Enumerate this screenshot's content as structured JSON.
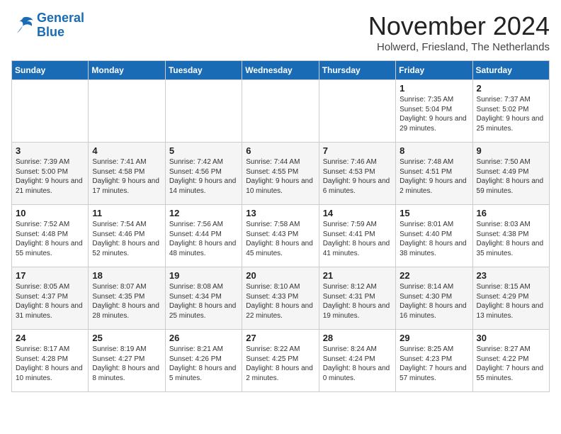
{
  "logo": {
    "line1": "General",
    "line2": "Blue"
  },
  "title": "November 2024",
  "subtitle": "Holwerd, Friesland, The Netherlands",
  "weekdays": [
    "Sunday",
    "Monday",
    "Tuesday",
    "Wednesday",
    "Thursday",
    "Friday",
    "Saturday"
  ],
  "weeks": [
    [
      {
        "day": "",
        "info": ""
      },
      {
        "day": "",
        "info": ""
      },
      {
        "day": "",
        "info": ""
      },
      {
        "day": "",
        "info": ""
      },
      {
        "day": "",
        "info": ""
      },
      {
        "day": "1",
        "info": "Sunrise: 7:35 AM\nSunset: 5:04 PM\nDaylight: 9 hours and 29 minutes."
      },
      {
        "day": "2",
        "info": "Sunrise: 7:37 AM\nSunset: 5:02 PM\nDaylight: 9 hours and 25 minutes."
      }
    ],
    [
      {
        "day": "3",
        "info": "Sunrise: 7:39 AM\nSunset: 5:00 PM\nDaylight: 9 hours and 21 minutes."
      },
      {
        "day": "4",
        "info": "Sunrise: 7:41 AM\nSunset: 4:58 PM\nDaylight: 9 hours and 17 minutes."
      },
      {
        "day": "5",
        "info": "Sunrise: 7:42 AM\nSunset: 4:56 PM\nDaylight: 9 hours and 14 minutes."
      },
      {
        "day": "6",
        "info": "Sunrise: 7:44 AM\nSunset: 4:55 PM\nDaylight: 9 hours and 10 minutes."
      },
      {
        "day": "7",
        "info": "Sunrise: 7:46 AM\nSunset: 4:53 PM\nDaylight: 9 hours and 6 minutes."
      },
      {
        "day": "8",
        "info": "Sunrise: 7:48 AM\nSunset: 4:51 PM\nDaylight: 9 hours and 2 minutes."
      },
      {
        "day": "9",
        "info": "Sunrise: 7:50 AM\nSunset: 4:49 PM\nDaylight: 8 hours and 59 minutes."
      }
    ],
    [
      {
        "day": "10",
        "info": "Sunrise: 7:52 AM\nSunset: 4:48 PM\nDaylight: 8 hours and 55 minutes."
      },
      {
        "day": "11",
        "info": "Sunrise: 7:54 AM\nSunset: 4:46 PM\nDaylight: 8 hours and 52 minutes."
      },
      {
        "day": "12",
        "info": "Sunrise: 7:56 AM\nSunset: 4:44 PM\nDaylight: 8 hours and 48 minutes."
      },
      {
        "day": "13",
        "info": "Sunrise: 7:58 AM\nSunset: 4:43 PM\nDaylight: 8 hours and 45 minutes."
      },
      {
        "day": "14",
        "info": "Sunrise: 7:59 AM\nSunset: 4:41 PM\nDaylight: 8 hours and 41 minutes."
      },
      {
        "day": "15",
        "info": "Sunrise: 8:01 AM\nSunset: 4:40 PM\nDaylight: 8 hours and 38 minutes."
      },
      {
        "day": "16",
        "info": "Sunrise: 8:03 AM\nSunset: 4:38 PM\nDaylight: 8 hours and 35 minutes."
      }
    ],
    [
      {
        "day": "17",
        "info": "Sunrise: 8:05 AM\nSunset: 4:37 PM\nDaylight: 8 hours and 31 minutes."
      },
      {
        "day": "18",
        "info": "Sunrise: 8:07 AM\nSunset: 4:35 PM\nDaylight: 8 hours and 28 minutes."
      },
      {
        "day": "19",
        "info": "Sunrise: 8:08 AM\nSunset: 4:34 PM\nDaylight: 8 hours and 25 minutes."
      },
      {
        "day": "20",
        "info": "Sunrise: 8:10 AM\nSunset: 4:33 PM\nDaylight: 8 hours and 22 minutes."
      },
      {
        "day": "21",
        "info": "Sunrise: 8:12 AM\nSunset: 4:31 PM\nDaylight: 8 hours and 19 minutes."
      },
      {
        "day": "22",
        "info": "Sunrise: 8:14 AM\nSunset: 4:30 PM\nDaylight: 8 hours and 16 minutes."
      },
      {
        "day": "23",
        "info": "Sunrise: 8:15 AM\nSunset: 4:29 PM\nDaylight: 8 hours and 13 minutes."
      }
    ],
    [
      {
        "day": "24",
        "info": "Sunrise: 8:17 AM\nSunset: 4:28 PM\nDaylight: 8 hours and 10 minutes."
      },
      {
        "day": "25",
        "info": "Sunrise: 8:19 AM\nSunset: 4:27 PM\nDaylight: 8 hours and 8 minutes."
      },
      {
        "day": "26",
        "info": "Sunrise: 8:21 AM\nSunset: 4:26 PM\nDaylight: 8 hours and 5 minutes."
      },
      {
        "day": "27",
        "info": "Sunrise: 8:22 AM\nSunset: 4:25 PM\nDaylight: 8 hours and 2 minutes."
      },
      {
        "day": "28",
        "info": "Sunrise: 8:24 AM\nSunset: 4:24 PM\nDaylight: 8 hours and 0 minutes."
      },
      {
        "day": "29",
        "info": "Sunrise: 8:25 AM\nSunset: 4:23 PM\nDaylight: 7 hours and 57 minutes."
      },
      {
        "day": "30",
        "info": "Sunrise: 8:27 AM\nSunset: 4:22 PM\nDaylight: 7 hours and 55 minutes."
      }
    ]
  ]
}
